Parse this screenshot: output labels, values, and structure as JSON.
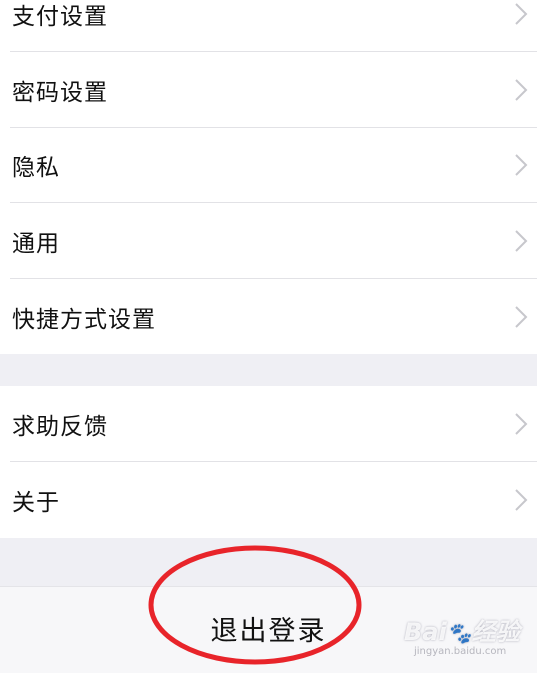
{
  "settings": {
    "group1": [
      {
        "label": "支付设置"
      },
      {
        "label": "密码设置"
      },
      {
        "label": "隐私"
      },
      {
        "label": "通用"
      },
      {
        "label": "快捷方式设置"
      }
    ],
    "group2": [
      {
        "label": "求助反馈"
      },
      {
        "label": "关于"
      }
    ]
  },
  "logout": {
    "label": "退出登录"
  },
  "annotation": {
    "color": "#e8242a"
  },
  "watermark": {
    "text": "Bai du 经验",
    "url": "jingyan.baidu.com"
  }
}
